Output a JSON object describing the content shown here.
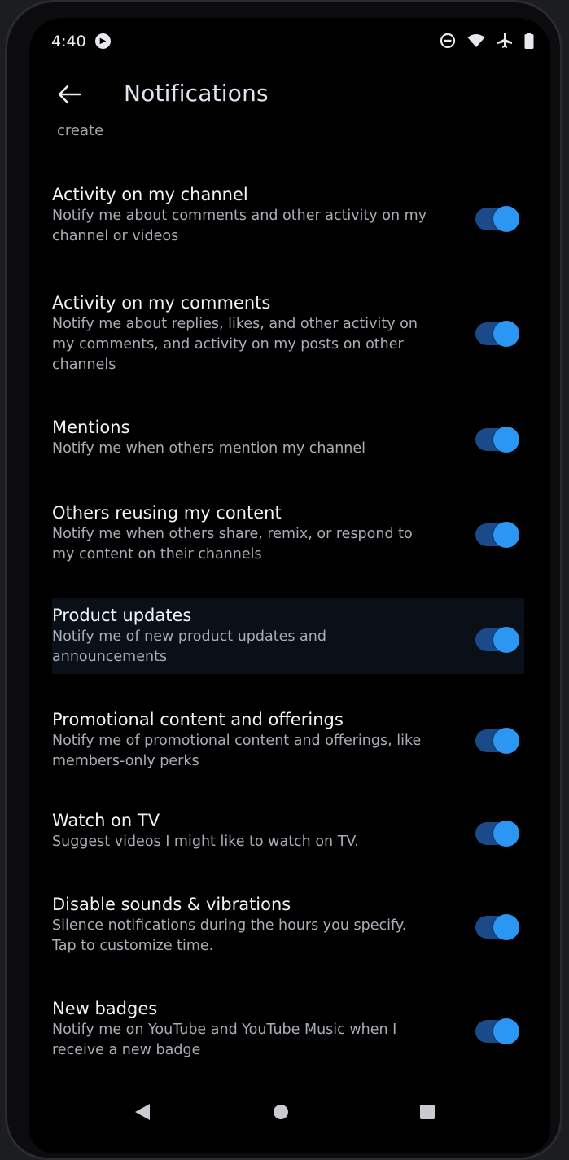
{
  "status_bar": {
    "time": "4:40",
    "icons": [
      "youtube-icon",
      "do-not-disturb-icon",
      "wifi-icon",
      "airplane-mode-icon",
      "battery-icon"
    ]
  },
  "header": {
    "title": "Notifications",
    "subtitle": "create"
  },
  "settings": [
    {
      "label": "Activity on my channel",
      "description": "Notify me about comments and other activity on my channel or videos",
      "enabled": true
    },
    {
      "label": "Activity on my comments",
      "description": "Notify me about replies, likes, and other activity on my comments, and activity on my posts on other channels",
      "enabled": true
    },
    {
      "label": "Mentions",
      "description": "Notify me when others mention my channel",
      "enabled": true
    },
    {
      "label": "Others reusing my content",
      "description": "Notify me when others share, remix, or respond to my content on their channels",
      "enabled": true
    },
    {
      "label": "Product updates",
      "description": "Notify me of new product updates and announcements",
      "enabled": true
    },
    {
      "label": "Promotional content and offerings",
      "description": "Notify me of promotional content and offerings, like members-only perks",
      "enabled": true
    },
    {
      "label": "Watch on TV",
      "description": "Suggest videos I might like to watch on TV.",
      "enabled": true
    },
    {
      "label": "Disable sounds & vibrations",
      "description": "Silence notifications during the hours you specify. Tap to customize time.",
      "enabled": true
    },
    {
      "label": "New badges",
      "description": "Notify me on YouTube and YouTube Music when I receive a new badge",
      "enabled": true
    }
  ],
  "colors": {
    "background": "#000000",
    "toggle_on_knob": "#2b97f2",
    "toggle_on_track": "#1a4a8a",
    "title": "#dfe6f0"
  },
  "navigation_bar": {
    "icons": [
      "back-triangle-icon",
      "home-circle-icon",
      "recents-square-icon"
    ]
  }
}
